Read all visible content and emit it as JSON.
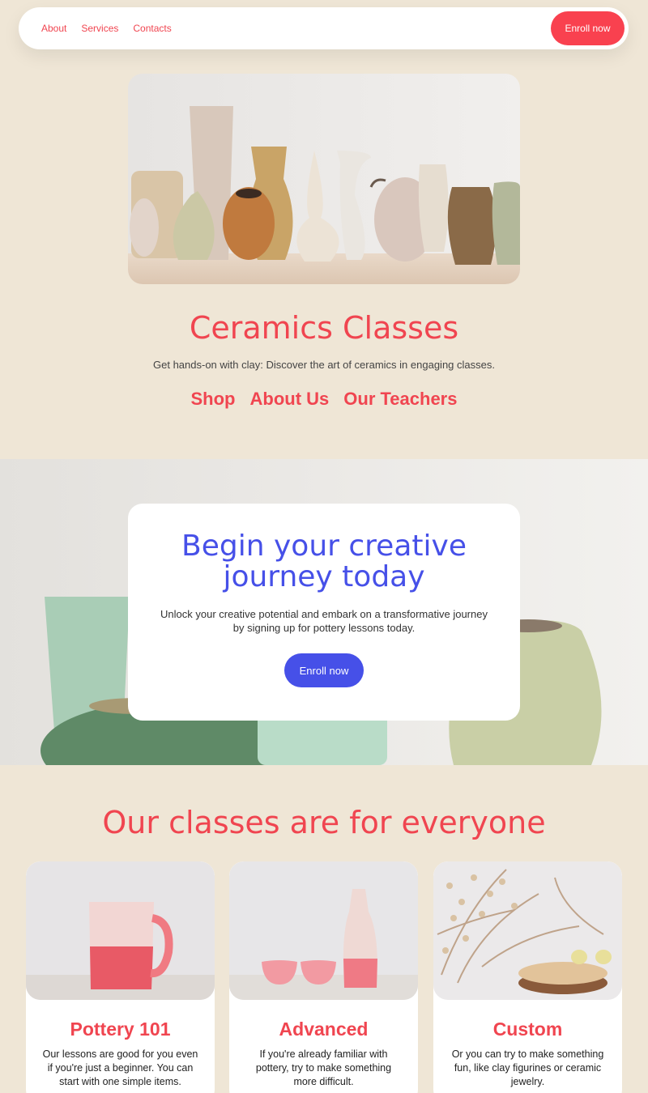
{
  "nav": {
    "links": [
      "About",
      "Services",
      "Contacts"
    ],
    "enroll_label": "Enroll now"
  },
  "hero": {
    "title": "Ceramics Classes",
    "subtitle": "Get hands-on with clay: Discover the art of ceramics in engaging classes.",
    "links": [
      "Shop",
      "About Us",
      "Our Teachers"
    ]
  },
  "cta": {
    "title_line1": "Begin your creative",
    "title_line2": "journey today",
    "text": "Unlock your creative potential and embark on a transformative journey by signing up for pottery lessons today.",
    "button_label": "Enroll now"
  },
  "classes": {
    "title": "Our classes are for everyone",
    "cards": [
      {
        "title": "Pottery 101",
        "text": "Our lessons are good for you even if you're just a beginner. You can start with one simple items."
      },
      {
        "title": "Advanced",
        "text": "If you're already familiar with pottery, try to make something more difficult."
      },
      {
        "title": "Custom",
        "text": "Or you can try to make something fun, like clay figurines or ceramic jewelry."
      }
    ]
  },
  "colors": {
    "accent_red": "#f04550",
    "accent_blue": "#4650e8",
    "background": "#efe6d6"
  }
}
